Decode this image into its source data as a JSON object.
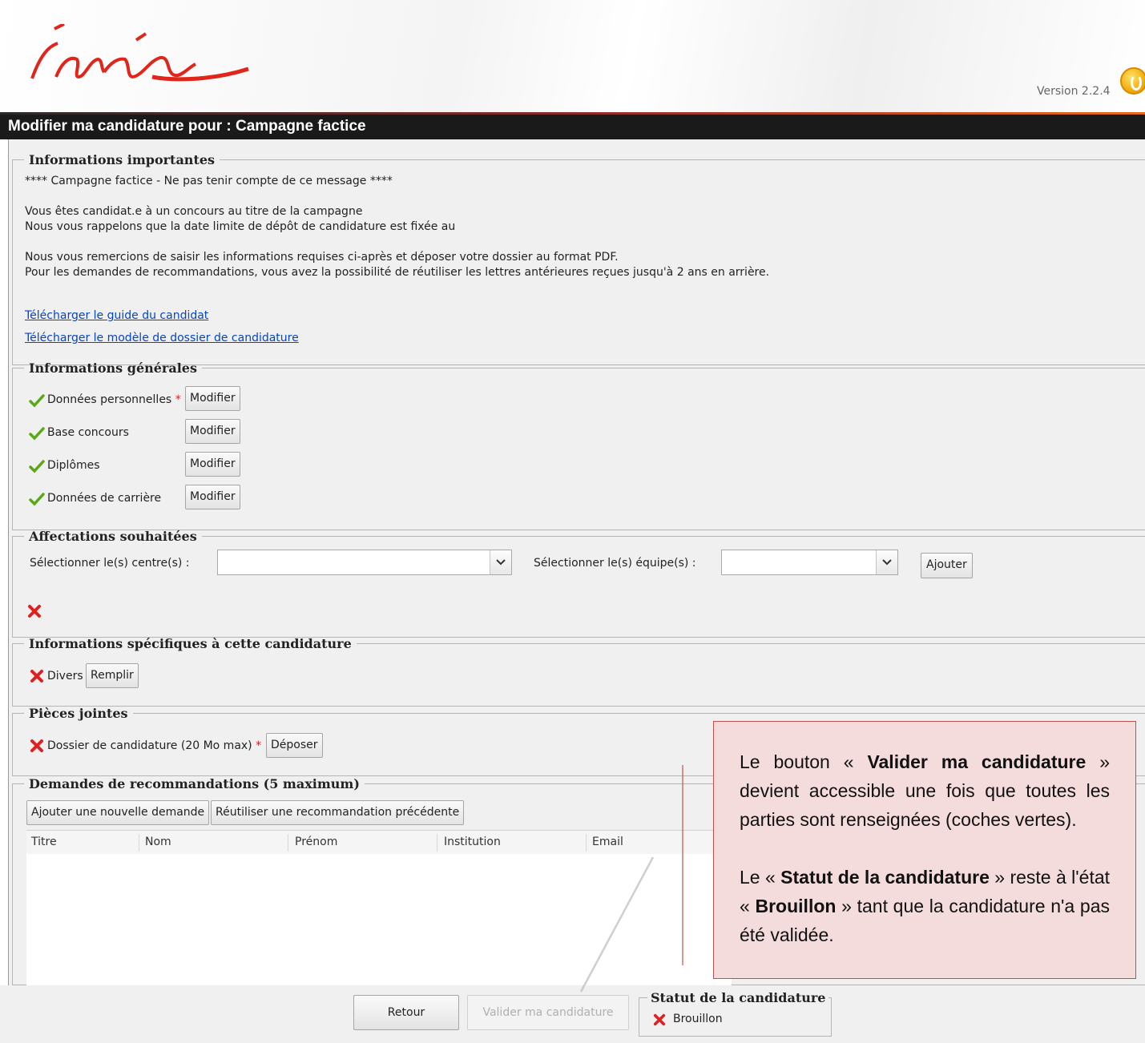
{
  "header": {
    "logo_text": "Inria",
    "version": "Version 2.2.4",
    "power_icon": "power-icon",
    "title": "Modifier ma candidature pour : Campagne factice"
  },
  "important_info": {
    "legend": "Informations importantes",
    "line_campaign": "**** Campagne factice - Ne pas tenir compte de ce message ****",
    "line_candidate": "Vous êtes candidat.e à un concours au titre de la campagne",
    "line_deadline": "Nous vous rappelons que la date limite de dépôt de candidature est fixée au",
    "line_please": "Nous vous remercions de saisir les informations requises ci-après et déposer votre dossier au format PDF.",
    "line_reco": "Pour les demandes de recommandations, vous avez la possibilité de réutiliser les lettres antérieures reçues jusqu'à 2 ans en arrière.",
    "link_guide": "Télécharger le guide du candidat",
    "link_model": "Télécharger le modèle de dossier de candidature"
  },
  "general_info": {
    "legend": "Informations générales",
    "items": [
      {
        "label": "Données personnelles",
        "required": "*",
        "button": "Modifier",
        "status": "check"
      },
      {
        "label": "Base concours",
        "button": "Modifier",
        "status": "check"
      },
      {
        "label": "Diplômes",
        "button": "Modifier",
        "status": "check"
      },
      {
        "label": "Données de carrière",
        "button": "Modifier",
        "status": "check"
      }
    ]
  },
  "assignments": {
    "legend": "Affectations souhaitées",
    "center_label": "Sélectionner le(s) centre(s) :",
    "center_value": "",
    "team_label": "Sélectionner le(s) équipe(s) :",
    "team_value": "",
    "add_button": "Ajouter",
    "status": "cross"
  },
  "specific_info": {
    "legend": "Informations spécifiques à cette candidature",
    "item_label": "Divers",
    "button": "Remplir",
    "status": "cross"
  },
  "attachments": {
    "legend": "Pièces jointes",
    "item_label": "Dossier de candidature (20 Mo max)",
    "required": "*",
    "button": "Déposer",
    "status": "cross"
  },
  "recommendations": {
    "legend": "Demandes de recommandations (5 maximum)",
    "add_button": "Ajouter une nouvelle demande",
    "reuse_button": "Réutiliser une recommandation précédente",
    "columns": [
      "Titre",
      "Nom",
      "Prénom",
      "Institution",
      "Email"
    ],
    "rows": []
  },
  "footer": {
    "back_button": "Retour",
    "validate_button": "Valider ma candidature",
    "status_legend": "Statut de la candidature",
    "status_value": "Brouillon",
    "status_icon": "cross"
  },
  "callout": {
    "p1_a": "Le bouton « ",
    "p1_b": "Valider ma candidature",
    "p1_c": " » devient accessible une fois que toutes les parties sont renseignées (coches vertes).",
    "p2_a": "Le « ",
    "p2_b": "Statut de la candidature",
    "p2_c": " » reste à l'état « ",
    "p2_d": "Brouillon",
    "p2_e": " » tant que la candidature n'a pas été validée."
  },
  "colors": {
    "brand_red": "#e0251b",
    "title_bar": "#1a1a1a",
    "link_blue": "#0645c8",
    "check_green": "#5aa816",
    "cross_red": "#e02020",
    "callout_bg": "#f5dcdc",
    "callout_border": "#c0504d"
  }
}
